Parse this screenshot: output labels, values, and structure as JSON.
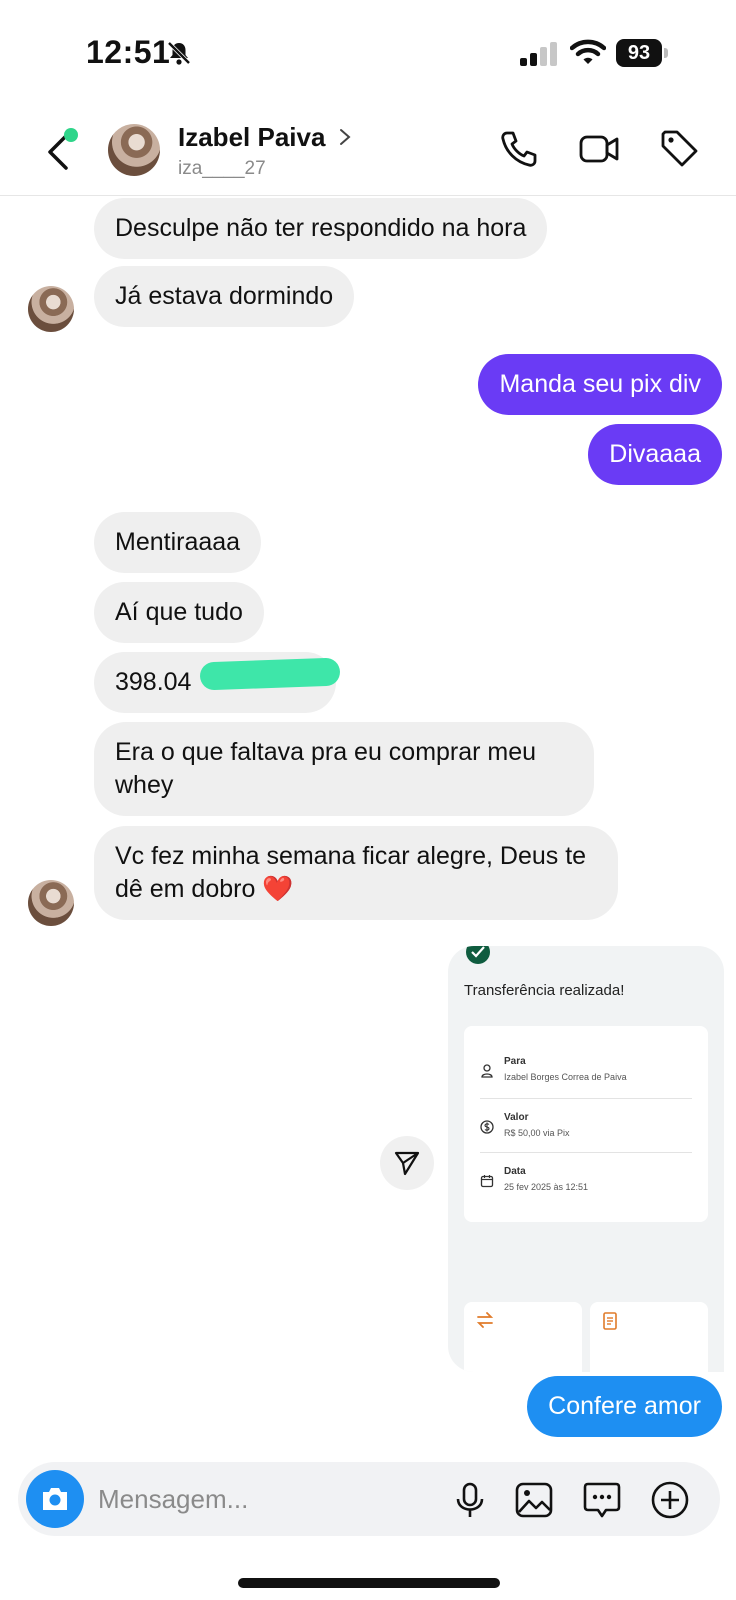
{
  "status_bar": {
    "time": "12:51",
    "battery": "93"
  },
  "header": {
    "name": "Izabel Paiva",
    "username": "iza____27"
  },
  "messages": [
    {
      "side": "in",
      "text": "Desculpe não ter respondido na hora"
    },
    {
      "side": "in",
      "text": "Já estava dormindo"
    },
    {
      "side": "out",
      "text": "Manda seu pix div"
    },
    {
      "side": "out",
      "text": "Divaaaa"
    },
    {
      "side": "in",
      "text": "Mentiraaaa"
    },
    {
      "side": "in",
      "text": "Aí que tudo"
    },
    {
      "side": "in",
      "text": "398.04"
    },
    {
      "side": "in",
      "text": "Era o que faltava pra eu comprar meu whey"
    },
    {
      "side": "in",
      "text": "Vc fez minha semana ficar alegre, Deus te dê em dobro ❤️"
    },
    {
      "side": "out",
      "text": "Confere amor"
    }
  ],
  "transfer_card": {
    "title": "Transferência realizada!",
    "rows": [
      {
        "label": "Para",
        "value": "Izabel Borges Correa de Paiva"
      },
      {
        "label": "Valor",
        "value": "R$ 50,00 via Pix"
      },
      {
        "label": "Data",
        "value": "25 fev 2025 às 12:51"
      }
    ]
  },
  "composer": {
    "placeholder": "Mensagem..."
  },
  "colors": {
    "outgoing_purple": "#6a3bf5",
    "outgoing_blue": "#1e8ff2",
    "incoming": "#efefef",
    "online": "#2fd58a"
  }
}
